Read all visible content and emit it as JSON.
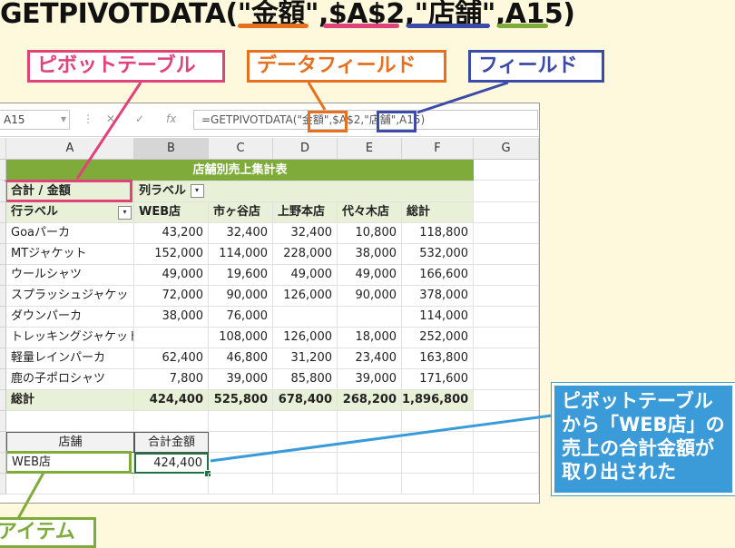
{
  "headline": {
    "text": "GETPIVOTDATA(\"金額\",$A$2,\"店舗\",A15)",
    "underline_colors": [
      "#e6701e",
      "#e0437a",
      "#3c4ba8",
      "#7fab3b"
    ]
  },
  "callouts": {
    "pivot_table": {
      "label": "ピボットテーブル",
      "color": "#e0437a"
    },
    "data_field": {
      "label": "データフィールド",
      "color": "#e6701e"
    },
    "field": {
      "label": "フィールド",
      "color": "#3c4ba8"
    },
    "item": {
      "label": "アイテム",
      "color": "#7fab3b"
    }
  },
  "formula_bar": {
    "name_box": "A15",
    "fx": "fx",
    "formula": "=GETPIVOTDATA(\"金額\",$A$2,\"店舗\",A15)"
  },
  "columns": [
    "A",
    "B",
    "C",
    "D",
    "E",
    "F",
    "G"
  ],
  "pivot": {
    "title": "店舗別売上集計表",
    "corner": "合計 / 金額",
    "col_label": "列ラベル",
    "row_label": "行ラベル",
    "headers": [
      "WEB店",
      "市ヶ谷店",
      "上野本店",
      "代々木店",
      "総計"
    ],
    "rows": [
      {
        "name": "Goaパーカ",
        "values": [
          "43,200",
          "32,400",
          "32,400",
          "10,800",
          "118,800"
        ]
      },
      {
        "name": "MTジャケット",
        "values": [
          "152,000",
          "114,000",
          "228,000",
          "38,000",
          "532,000"
        ]
      },
      {
        "name": "ウールシャツ",
        "values": [
          "49,000",
          "19,600",
          "49,000",
          "49,000",
          "166,600"
        ]
      },
      {
        "name": "スプラッシュジャケッ",
        "values": [
          "72,000",
          "90,000",
          "126,000",
          "90,000",
          "378,000"
        ]
      },
      {
        "name": "ダウンパーカ",
        "values": [
          "38,000",
          "76,000",
          "",
          "",
          "114,000"
        ]
      },
      {
        "name": "トレッキングジャケット",
        "values": [
          "",
          "108,000",
          "126,000",
          "18,000",
          "252,000"
        ]
      },
      {
        "name": "軽量レインパーカ",
        "values": [
          "62,400",
          "46,800",
          "31,200",
          "23,400",
          "163,800"
        ]
      },
      {
        "name": "鹿の子ポロシャツ",
        "values": [
          "7,800",
          "39,000",
          "85,800",
          "39,000",
          "171,600"
        ]
      }
    ],
    "total": {
      "name": "総計",
      "values": [
        "424,400",
        "525,800",
        "678,400",
        "268,200",
        "1,896,800"
      ]
    }
  },
  "lookup": {
    "store_header": "店舗",
    "amount_header": "合計金額",
    "store_value": "WEB店",
    "amount_value": "424,400"
  },
  "note": {
    "lines": [
      "ピボットテーブル",
      "から「WEB店」の",
      "売上の合計金額が",
      "取り出された"
    ]
  }
}
